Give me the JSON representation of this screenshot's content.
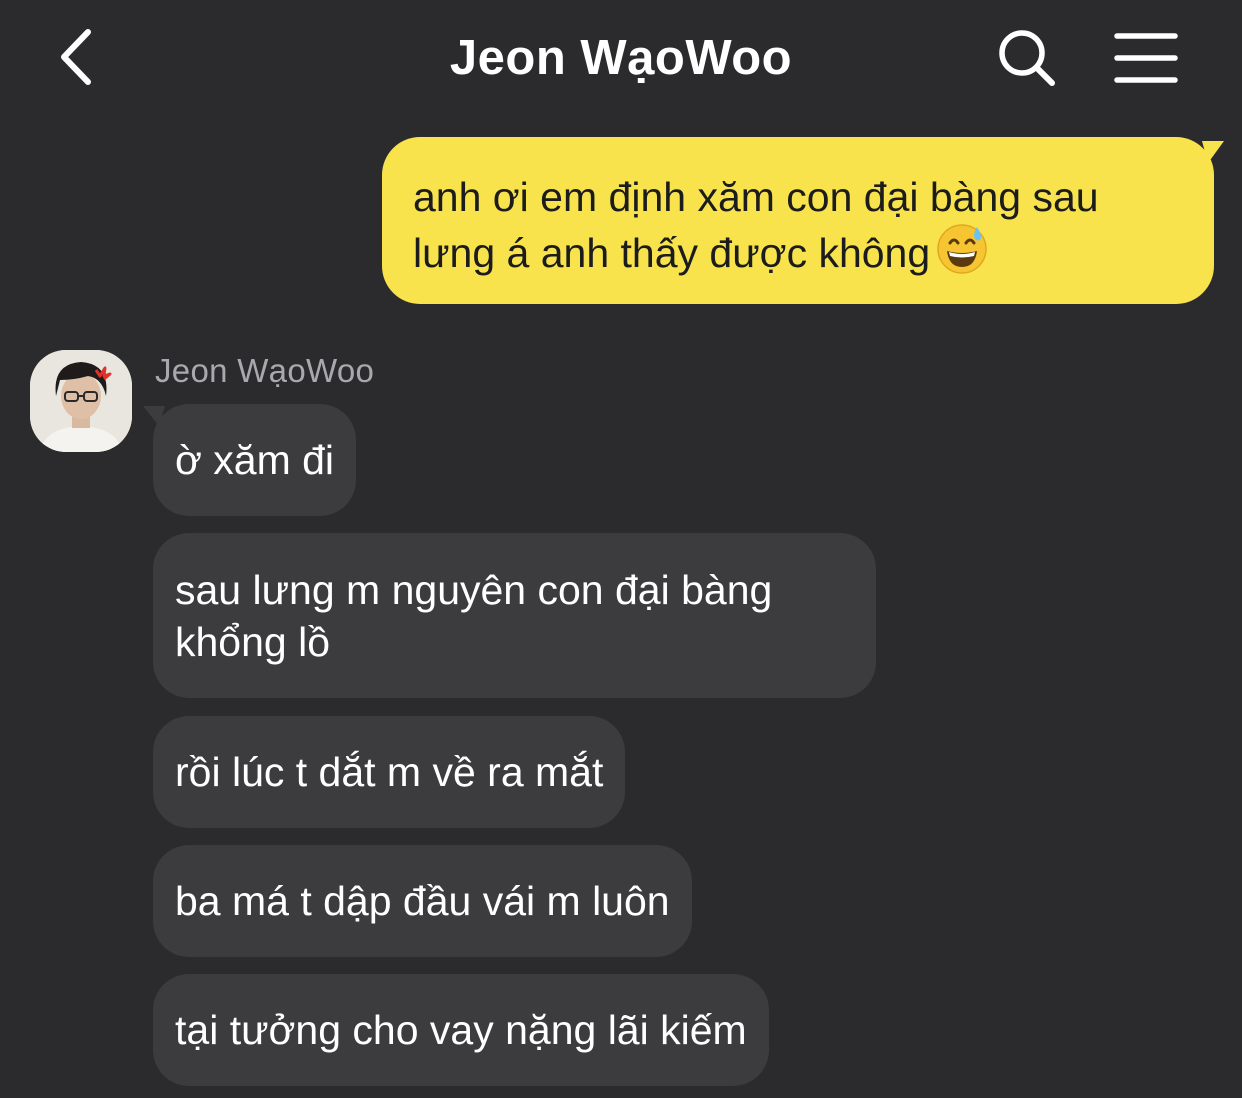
{
  "header": {
    "title": "Jeon WạoWoo",
    "back_icon": "chevron-left-icon",
    "search_icon": "search-icon",
    "menu_icon": "hamburger-menu-icon"
  },
  "outgoing": {
    "text": "anh ơi em định xăm con đại bàng sau lưng á anh thấy được không",
    "emoji": "grinning-face-with-sweat-emoji",
    "bubble_color": "#f9e34d"
  },
  "incoming": {
    "sender": "Jeon WạoWoo",
    "bubble_color": "#3c3c3f",
    "messages": [
      "ờ xăm đi",
      "sau lưng m nguyên con đại bàng khổng lồ",
      "rồi lúc t dắt m về ra mắt",
      "ba má t dập đầu vái m luôn",
      "tại tưởng cho vay nặng lãi kiếm"
    ]
  },
  "colors": {
    "background": "#2b2b2d",
    "title_text": "#ffffff",
    "sender_text": "#a9a9ad"
  }
}
